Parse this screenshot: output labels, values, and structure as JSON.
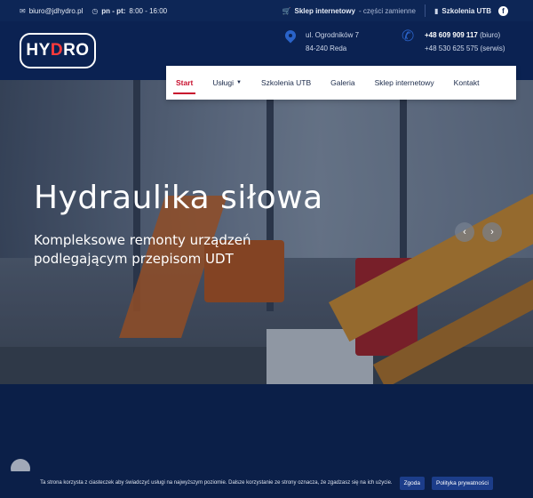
{
  "topbar": {
    "email": "biuro@jdhydro.pl",
    "hours_label": "pn - pt:",
    "hours_value": "8:00 - 16:00",
    "shop_label": "Sklep internetowy",
    "shop_sub": "- części zamienne",
    "training_label": "Szkolenia UTB",
    "facebook": "f"
  },
  "header": {
    "logo_left": "HY",
    "logo_mid": "D",
    "logo_right": "RO",
    "address_line1": "ul. Ogrodników 7",
    "address_line2": "84-240 Reda",
    "phone1_number": "+48 609 909 117",
    "phone1_note": "(biuro)",
    "phone2": "+48 530 625 575 (serwis)"
  },
  "nav": {
    "items": [
      {
        "label": "Start"
      },
      {
        "label": "Usługi"
      },
      {
        "label": "Szkolenia UTB"
      },
      {
        "label": "Galeria"
      },
      {
        "label": "Sklep internetowy"
      },
      {
        "label": "Kontakt"
      }
    ]
  },
  "hero": {
    "title": "Hydraulika siłowa",
    "subtitle_line1": "Kompleksowe remonty urządzeń",
    "subtitle_line2": "podlegającym przepisom UDT",
    "prev": "‹",
    "next": "›"
  },
  "cookie": {
    "text": "Ta strona korzysta z ciasteczek aby świadczyć usługi na najwyższym poziomie. Dalsze korzystanie ze strony oznacza, że zgadzasz się na ich użycie.",
    "accept": "Zgoda",
    "privacy": "Polityka prywatności"
  },
  "colors": {
    "navy": "#0b2252",
    "accent_red": "#c8102e",
    "pin_blue": "#2a63c9"
  }
}
